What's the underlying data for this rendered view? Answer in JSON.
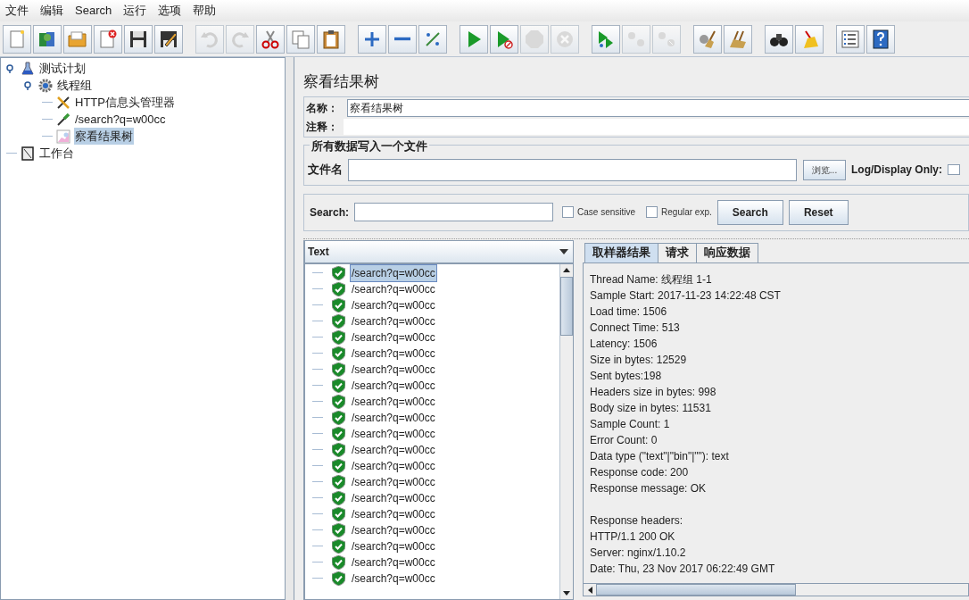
{
  "menu": [
    "文件",
    "编辑",
    "Search",
    "运行",
    "选项",
    "帮助"
  ],
  "toolbar": [
    {
      "kind": "new",
      "disabled": false
    },
    {
      "kind": "templates",
      "disabled": false
    },
    {
      "kind": "open",
      "disabled": false
    },
    {
      "kind": "close",
      "disabled": false
    },
    {
      "kind": "save",
      "disabled": false
    },
    {
      "kind": "saveas",
      "disabled": false
    },
    {
      "kind": "sep"
    },
    {
      "kind": "undo",
      "disabled": true
    },
    {
      "kind": "redo",
      "disabled": true
    },
    {
      "kind": "cut",
      "disabled": false
    },
    {
      "kind": "copy",
      "disabled": false
    },
    {
      "kind": "paste",
      "disabled": false
    },
    {
      "kind": "sep"
    },
    {
      "kind": "expand",
      "disabled": false
    },
    {
      "kind": "collapse",
      "disabled": false
    },
    {
      "kind": "toggle",
      "disabled": false
    },
    {
      "kind": "sep"
    },
    {
      "kind": "start",
      "disabled": false
    },
    {
      "kind": "startnopause",
      "disabled": false
    },
    {
      "kind": "stop",
      "disabled": true
    },
    {
      "kind": "shutdown",
      "disabled": true
    },
    {
      "kind": "sep"
    },
    {
      "kind": "remotestart",
      "disabled": false
    },
    {
      "kind": "remotestop",
      "disabled": true
    },
    {
      "kind": "remoteexit",
      "disabled": true
    },
    {
      "kind": "sep"
    },
    {
      "kind": "clear",
      "disabled": false
    },
    {
      "kind": "clearall",
      "disabled": false
    },
    {
      "kind": "sep"
    },
    {
      "kind": "search",
      "disabled": false
    },
    {
      "kind": "resetsearch",
      "disabled": false
    },
    {
      "kind": "sep"
    },
    {
      "kind": "functions",
      "disabled": false
    },
    {
      "kind": "help",
      "disabled": false
    }
  ],
  "tree": [
    {
      "label": "测试计划",
      "kind": "plan",
      "selected": false,
      "expanded": true,
      "children": [
        {
          "label": "线程组",
          "kind": "threads",
          "selected": false,
          "expanded": true,
          "children": [
            {
              "label": "HTTP信息头管理器",
              "kind": "tools",
              "selected": false
            },
            {
              "label": "/search?q=w00cc",
              "kind": "sampler",
              "selected": false
            },
            {
              "label": "察看结果树",
              "kind": "graph",
              "selected": true
            }
          ]
        }
      ]
    },
    {
      "label": "工作台",
      "kind": "workbench",
      "selected": false
    }
  ],
  "panel": {
    "title": "察看结果树",
    "name_label": "名称：",
    "name_value": "察看结果树",
    "comment_label": "注释：",
    "file_group": "所有数据写入一个文件",
    "file_label": "文件名",
    "browse": "浏览...",
    "log_only": "Log/Display Only:",
    "log_only_checked": false,
    "search_label": "Search:",
    "case_sensitive": {
      "label": "Case sensitive",
      "checked": false
    },
    "regex": {
      "label": "Regular exp.",
      "checked": false
    },
    "search_button": "Search",
    "reset_button": "Reset"
  },
  "renderer": "Text",
  "results": [
    {
      "label": "/search?q=w00cc",
      "selected": true
    },
    {
      "label": "/search?q=w00cc",
      "selected": false
    },
    {
      "label": "/search?q=w00cc",
      "selected": false
    },
    {
      "label": "/search?q=w00cc",
      "selected": false
    },
    {
      "label": "/search?q=w00cc",
      "selected": false
    },
    {
      "label": "/search?q=w00cc",
      "selected": false
    },
    {
      "label": "/search?q=w00cc",
      "selected": false
    },
    {
      "label": "/search?q=w00cc",
      "selected": false
    },
    {
      "label": "/search?q=w00cc",
      "selected": false
    },
    {
      "label": "/search?q=w00cc",
      "selected": false
    },
    {
      "label": "/search?q=w00cc",
      "selected": false
    },
    {
      "label": "/search?q=w00cc",
      "selected": false
    },
    {
      "label": "/search?q=w00cc",
      "selected": false
    },
    {
      "label": "/search?q=w00cc",
      "selected": false
    },
    {
      "label": "/search?q=w00cc",
      "selected": false
    },
    {
      "label": "/search?q=w00cc",
      "selected": false
    },
    {
      "label": "/search?q=w00cc",
      "selected": false
    },
    {
      "label": "/search?q=w00cc",
      "selected": false
    },
    {
      "label": "/search?q=w00cc",
      "selected": false
    },
    {
      "label": "/search?q=w00cc",
      "selected": false
    }
  ],
  "tabs": [
    {
      "label": "取样器结果",
      "selected": true
    },
    {
      "label": "请求",
      "selected": false
    },
    {
      "label": "响应数据",
      "selected": false
    }
  ],
  "details": [
    [
      "Thread Name: 线程组 1-1",
      "Sample Start: 2017-11-23 14:22:48 CST",
      "Load time: 1506",
      "Connect Time: 513",
      "Latency: 1506",
      "Size in bytes: 12529",
      "Sent bytes:198",
      "Headers size in bytes: 998",
      "Body size in bytes: 11531",
      "Sample Count: 1",
      "Error Count: 0",
      "Data type (\"text\"|\"bin\"|\"\"): text",
      "Response code: 200",
      "Response message: OK"
    ],
    [
      "Response headers:",
      "HTTP/1.1 200 OK",
      "Server: nginx/1.10.2",
      "Date: Thu, 23 Nov 2017 06:22:49 GMT"
    ]
  ]
}
